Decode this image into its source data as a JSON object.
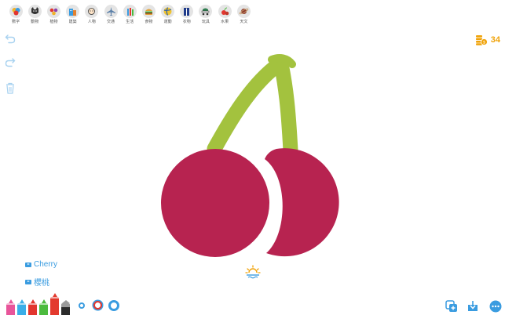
{
  "categories": [
    {
      "label": "數字",
      "icon": "palette-icon"
    },
    {
      "label": "動物",
      "icon": "cat-icon"
    },
    {
      "label": "植物",
      "icon": "flower-icon"
    },
    {
      "label": "建築",
      "icon": "building-icon"
    },
    {
      "label": "人物",
      "icon": "person-icon"
    },
    {
      "label": "交通",
      "icon": "plane-icon"
    },
    {
      "label": "生活",
      "icon": "toiletries-icon"
    },
    {
      "label": "食物",
      "icon": "burger-icon"
    },
    {
      "label": "運動",
      "icon": "volleyball-icon"
    },
    {
      "label": "衣物",
      "icon": "clothes-icon"
    },
    {
      "label": "玩具",
      "icon": "toy-icon"
    },
    {
      "label": "水果",
      "icon": "fruit-icon"
    },
    {
      "label": "天文",
      "icon": "planet-icon"
    }
  ],
  "coins": {
    "count": "34"
  },
  "words": {
    "english": "Cherry",
    "chinese": "櫻桃"
  },
  "colors": {
    "accent": "#3a9ce0",
    "cherry": "#b72350",
    "stem": "#a3c23e",
    "coin": "#f0a30a"
  },
  "pens": [
    {
      "color": "#e8559a",
      "selected": false
    },
    {
      "color": "#3aaee8",
      "selected": false
    },
    {
      "color": "#e2362f",
      "selected": false
    },
    {
      "color": "#4cbb3e",
      "selected": false
    },
    {
      "color": "#e33a2e",
      "selected": true
    },
    {
      "color": "#2b2b2b",
      "selected": false
    }
  ]
}
